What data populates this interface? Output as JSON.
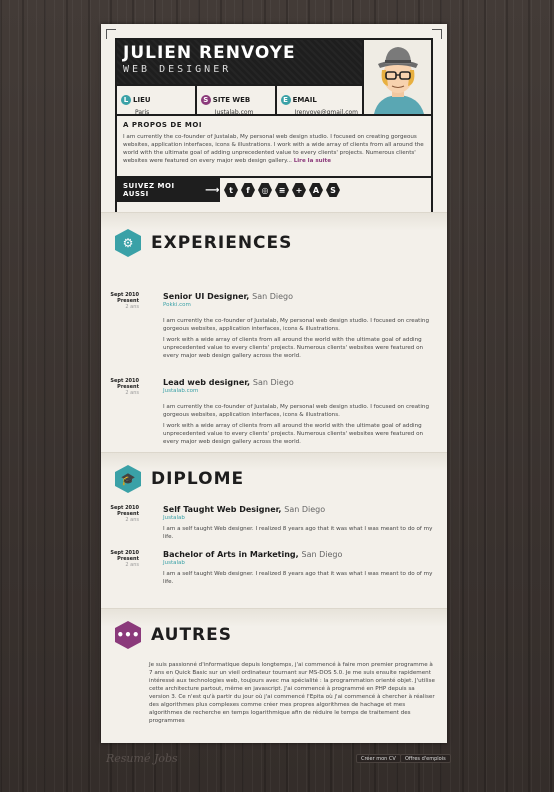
{
  "header": {
    "name": "Julien Renvoye",
    "role": "Web Designer",
    "info": [
      {
        "icon": "location-icon",
        "glyph": "L",
        "color": "#3aa1a7",
        "label": "Lieu",
        "value": "Paris"
      },
      {
        "icon": "web-icon",
        "glyph": "S",
        "color": "#8b3a7b",
        "label": "Site Web",
        "value": "Justalab.com"
      },
      {
        "icon": "email-icon",
        "glyph": "E",
        "color": "#3aa1a7",
        "label": "Email",
        "value": "Jrenvoye@gmail.com"
      }
    ],
    "about_title": "A propos de moi",
    "about_text": "I am currently the co-founder of Justalab, My personal web design studio. I focused on creating gorgeous websites, application interfaces, icons & illustrations. I work with a wide array of clients from all around the world with the ultimate goal of adding unprecedented value to every clients' projects. Numerous clients' websites were featured on every major web design gallery...",
    "about_more": "Lire la suite",
    "follow_label": "Suivez moi aussi",
    "socials": [
      {
        "name": "twitter-icon",
        "glyph": "t"
      },
      {
        "name": "facebook-icon",
        "glyph": "f"
      },
      {
        "name": "dribbble-icon",
        "glyph": "◎"
      },
      {
        "name": "forrst-icon",
        "glyph": "≡"
      },
      {
        "name": "googleplus-icon",
        "glyph": "+"
      },
      {
        "name": "app-icon",
        "glyph": "A"
      },
      {
        "name": "skype-icon",
        "glyph": "S"
      }
    ]
  },
  "experiences": {
    "title": "Experiences",
    "icon_color": "#3aa1a7",
    "items": [
      {
        "date_start": "Sept 2010",
        "date_end": "Present",
        "duration": "2 ans",
        "title": "Senior UI Designer",
        "location": "San Diego",
        "company": "Pokki.com",
        "p1": "I am currently the co-founder of Justalab, My personal web design studio. I focused on creating gorgeous websites, application interfaces, icons & illustrations.",
        "p2": "I work with a wide array of clients from all around the world with the ultimate goal of adding unprecedented value to every clients' projects. Numerous clients' websites were featured on every major web design gallery across the world."
      },
      {
        "date_start": "Sept 2010",
        "date_end": "Present",
        "duration": "2 ans",
        "title": "Lead web designer",
        "location": "San Diego",
        "company": "Justalab.com",
        "p1": "I am currently the co-founder of Justalab, My personal web design studio. I focused on creating gorgeous websites, application interfaces, icons & illustrations.",
        "p2": "I work with a wide array of clients from all around the world with the ultimate goal of adding unprecedented value to every clients' projects. Numerous clients' websites were featured on every major web design gallery across the world."
      }
    ]
  },
  "diplome": {
    "title": "Diplome",
    "icon_color": "#3aa1a7",
    "items": [
      {
        "date_start": "Sept 2010",
        "date_end": "Present",
        "duration": "2 ans",
        "title": "Self Taught Web Designer",
        "location": "San Diego",
        "company": "Justalab",
        "p1": "I am a self taught Web designer. I realized 8 years ago that it was what I was meant to do of my life."
      },
      {
        "date_start": "Sept 2010",
        "date_end": "Present",
        "duration": "2 ans",
        "title": "Bachelor of Arts in Marketing",
        "location": "San Diego",
        "company": "Justalab",
        "p1": "I am a self taught Web designer. I realized 8 years ago that it was what I was meant to do of my life."
      }
    ]
  },
  "autres": {
    "title": "Autres",
    "icon_color": "#8b3a7b",
    "text": "Je suis passionné d'informatique depuis longtemps, j'ai commencé à faire mon premier programme à 7 ans en Quick Basic sur un vieil ordinateur tournant sur MS-DOS 5.0. Je me suis ensuite rapidement intéressé aux technologies web, toujours avec ma spécialité : la programmation orienté objet. J'utilise cette architecture partout, même en javascript. J'ai commencé à programmé en PHP depuis sa version 3. Ce n'est qu'à partir du jour où j'ai commencé l'Epita où j'ai commencé à chercher à réaliser des algorithmes plus complexes comme créer mes propres algorithmes de hachage et mes algorithmes de recherche en temps logarithmique afin de réduire le temps de traitement des programmes"
  },
  "footer": {
    "logo": "Resumé Jobs",
    "create_cv": "Créer mon CV",
    "offers": "Offres d'emplois"
  }
}
